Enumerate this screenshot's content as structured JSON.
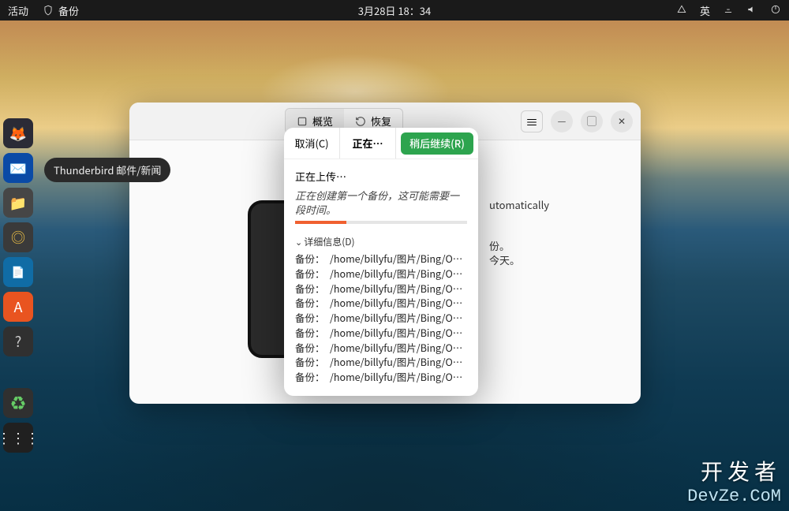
{
  "topbar": {
    "activities": "活动",
    "app_name": "备份",
    "clock": "3月28日  18：34",
    "ime": "英"
  },
  "tooltip": "Thunderbird 邮件/新闻",
  "dock": {
    "items": [
      {
        "name": "firefox"
      },
      {
        "name": "thunderbird"
      },
      {
        "name": "files"
      },
      {
        "name": "rhythmbox"
      },
      {
        "name": "writer"
      },
      {
        "name": "software"
      },
      {
        "name": "help"
      },
      {
        "name": "trash"
      },
      {
        "name": "apps-grid"
      }
    ]
  },
  "window": {
    "tab_overview": "概览",
    "tab_restore": "恢复",
    "body_auto_suffix": "utomatically",
    "bg_line_suffix1": "份。",
    "bg_line_suffix2": "今天。"
  },
  "dialog": {
    "cancel": "取消(C)",
    "title": "正在…",
    "resume": "稍后继续(R)",
    "uploading": "正在上传…",
    "first_backup": "正在创建第一个备份，这可能需要一段时间。",
    "details_label": "详细信息(D)",
    "backup_label": "备份：",
    "files": [
      "/home/billyfu/图片/Bing/OHR.Buc",
      "/home/billyfu/图片/Bing/OHR.Cam",
      "/home/billyfu/图片/Bing/OHR.Cap",
      "/home/billyfu/图片/Bing/OHR.Cap",
      "/home/billyfu/图片/Bing/OHR.Cast",
      "/home/billyfu/图片/Bing/OHR.Cava",
      "/home/billyfu/图片/Bing/OHR.Cha",
      "/home/billyfu/图片/Bing/OHR.Che",
      "/home/billyfu/图片/Bing/OHR.Clar"
    ]
  },
  "watermark": {
    "l1": "开发者",
    "l2": "DevZe.CoM"
  }
}
